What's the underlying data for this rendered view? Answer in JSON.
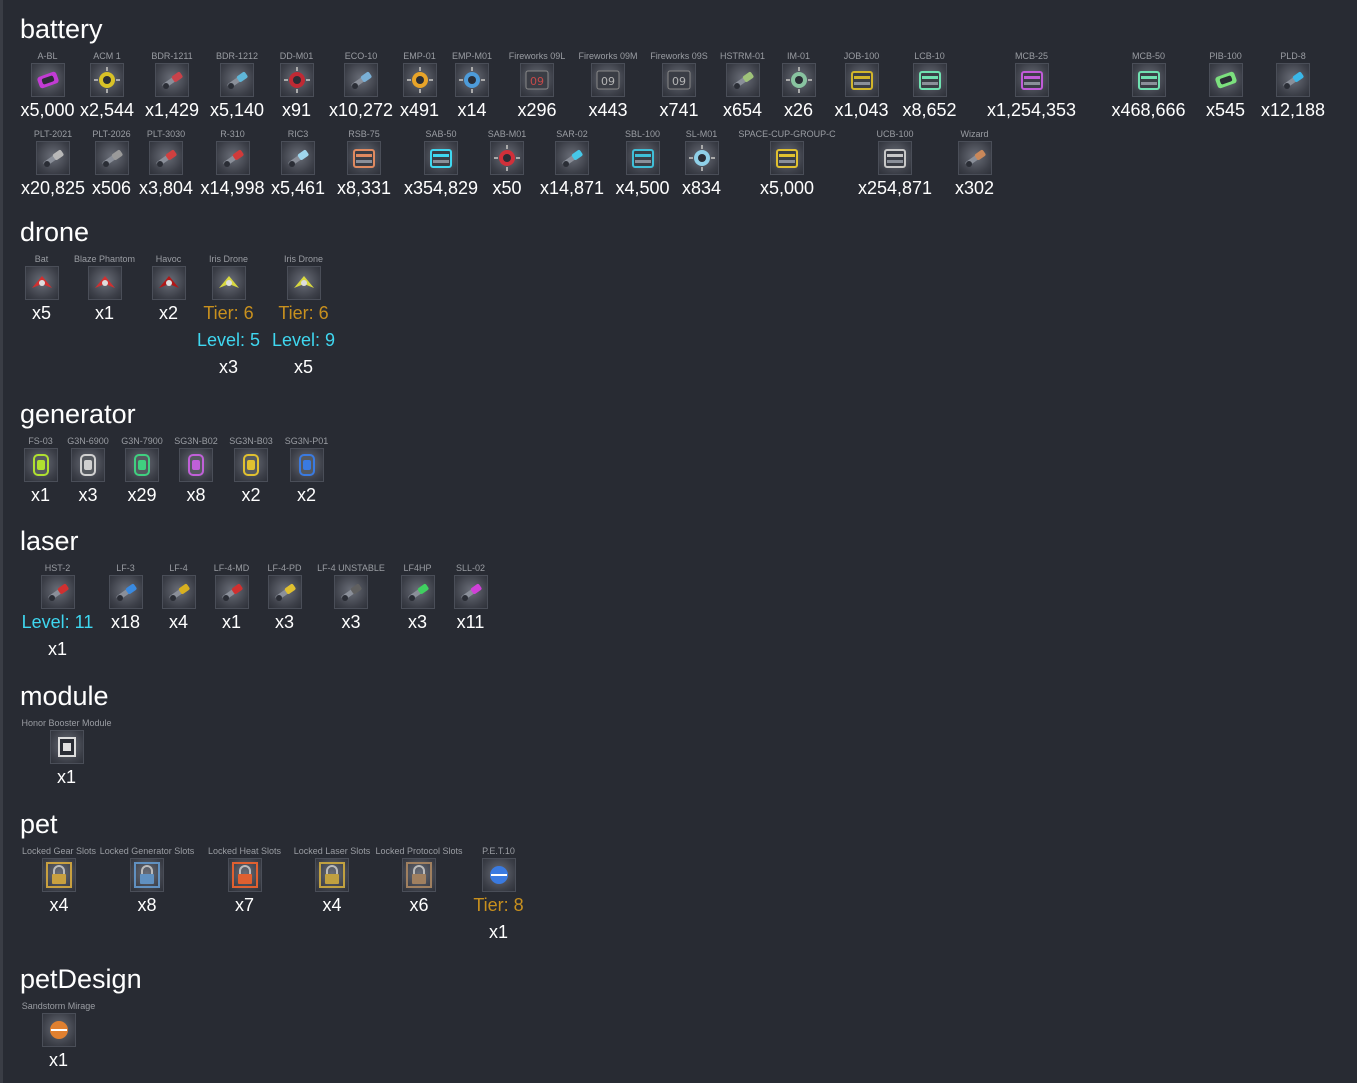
{
  "colors": {
    "background": "#282b33",
    "item_name": "#9a9da3",
    "tier": "#c8901e",
    "level": "#3fd7f0",
    "quantity": "#ffffff"
  },
  "categories": [
    {
      "title": "battery",
      "rows": [
        [
          {
            "name": "A-BL",
            "qty": "x5,000",
            "icon": "battery-abl-icon",
            "color": "#c23bd4"
          },
          {
            "name": "ACM 1",
            "qty": "x2,544",
            "icon": "mine-acm-icon",
            "color": "#d9c227"
          },
          {
            "name": "BDR-1211",
            "qty": "x1,429",
            "icon": "rocket-bdr1211-icon",
            "color": "#c9424a"
          },
          {
            "name": "BDR-1212",
            "qty": "x5,140",
            "icon": "rocket-bdr1212-icon",
            "color": "#5fb6d8"
          },
          {
            "name": "DD-M01",
            "qty": "x91",
            "icon": "mine-ddm01-icon",
            "color": "#c02a34"
          },
          {
            "name": "ECO-10",
            "qty": "x10,272",
            "icon": "rocket-eco10-icon",
            "color": "#7ab0d6"
          },
          {
            "name": "EMP-01",
            "qty": "x491",
            "icon": "emp-icon",
            "color": "#e8a429"
          },
          {
            "name": "EMP-M01",
            "qty": "x14",
            "icon": "mine-empm01-icon",
            "color": "#4d9bd9"
          },
          {
            "name": "Fireworks 09L",
            "qty": "x296",
            "icon": "fireworks-large-icon",
            "color": "#c64a4a"
          },
          {
            "name": "Fireworks 09M",
            "qty": "x443",
            "icon": "fireworks-medium-icon",
            "color": "#b5b5b5"
          },
          {
            "name": "Fireworks 09S",
            "qty": "x741",
            "icon": "fireworks-small-icon",
            "color": "#b5b5b5"
          },
          {
            "name": "HSTRM-01",
            "qty": "x654",
            "icon": "rocket-hstrm-icon",
            "color": "#9fc37a"
          },
          {
            "name": "IM-01",
            "qty": "x26",
            "icon": "mine-im01-icon",
            "color": "#88c3a0"
          },
          {
            "name": "JOB-100",
            "qty": "x1,043",
            "icon": "crate-job100-icon",
            "color": "#d2b52a"
          },
          {
            "name": "LCB-10",
            "qty": "x8,652",
            "icon": "crate-lcb10-icon",
            "color": "#6fe0b0"
          },
          {
            "name": "MCB-25",
            "qty": "x1,254,353",
            "icon": "crate-mcb25-icon",
            "color": "#c15bd8"
          },
          {
            "name": "MCB-50",
            "qty": "x468,666",
            "icon": "crate-mcb50-icon",
            "color": "#6fe0b0"
          },
          {
            "name": "PIB-100",
            "qty": "x545",
            "icon": "battery-pib100-icon",
            "color": "#7ce07e"
          },
          {
            "name": "PLD-8",
            "qty": "x12,188",
            "icon": "rocket-pld8-icon",
            "color": "#3ab7e8"
          }
        ],
        [
          {
            "name": "PLT-2021",
            "qty": "x20,825",
            "icon": "rocket-plt2021-icon",
            "color": "#b8b8b8"
          },
          {
            "name": "PLT-2026",
            "qty": "x506",
            "icon": "rocket-plt2026-icon",
            "color": "#9a9a9a"
          },
          {
            "name": "PLT-3030",
            "qty": "x3,804",
            "icon": "rocket-plt3030-icon",
            "color": "#d04040"
          },
          {
            "name": "R-310",
            "qty": "x14,998",
            "icon": "rocket-r310-icon",
            "color": "#d03a3a"
          },
          {
            "name": "RIC3",
            "qty": "x5,461",
            "icon": "rocket-ric3-icon",
            "color": "#9fd7ee"
          },
          {
            "name": "RSB-75",
            "qty": "x8,331",
            "icon": "crate-rsb75-icon",
            "color": "#e08a60"
          },
          {
            "name": "SAB-50",
            "qty": "x354,829",
            "icon": "crate-sab50-icon",
            "color": "#3fd7f0"
          },
          {
            "name": "SAB-M01",
            "qty": "x50",
            "icon": "mine-sabm01-icon",
            "color": "#d0303a"
          },
          {
            "name": "SAR-02",
            "qty": "x14,871",
            "icon": "rocket-sar02-icon",
            "color": "#46c8e8"
          },
          {
            "name": "SBL-100",
            "qty": "x4,500",
            "icon": "crate-sbl100-icon",
            "color": "#3fbfd8"
          },
          {
            "name": "SL-M01",
            "qty": "x834",
            "icon": "mine-slm01-icon",
            "color": "#8fd0e8"
          },
          {
            "name": "SPACE-CUP-GROUP-C",
            "qty": "x5,000",
            "icon": "space-cup-icon",
            "color": "#e0c030"
          },
          {
            "name": "UCB-100",
            "qty": "x254,871",
            "icon": "crate-ucb100-icon",
            "color": "#c8c8c8"
          },
          {
            "name": "Wizard",
            "qty": "x302",
            "icon": "rocket-wizard-icon",
            "color": "#c9885a"
          }
        ]
      ]
    },
    {
      "title": "drone",
      "rows": [
        [
          {
            "name": "Bat",
            "qty": "x5",
            "icon": "drone-bat-icon",
            "color": "#d03030"
          },
          {
            "name": "Blaze Phantom",
            "qty": "x1",
            "icon": "drone-blaze-phantom-icon",
            "color": "#d03030"
          },
          {
            "name": "Havoc",
            "qty": "x2",
            "icon": "drone-havoc-icon",
            "color": "#b01818"
          },
          {
            "name": "Iris Drone",
            "tier": "Tier: 6",
            "level": "Level: 5",
            "qty": "x3",
            "icon": "drone-iris-icon",
            "color": "#d8d840"
          },
          {
            "name": "Iris Drone",
            "tier": "Tier: 6",
            "level": "Level: 9",
            "qty": "x5",
            "icon": "drone-iris-icon",
            "color": "#d8d840"
          }
        ]
      ]
    },
    {
      "title": "generator",
      "rows": [
        [
          {
            "name": "FS-03",
            "qty": "x1",
            "icon": "generator-fs03-icon",
            "color": "#b0e030"
          },
          {
            "name": "G3N-6900",
            "qty": "x3",
            "icon": "generator-g3n6900-icon",
            "color": "#d0d0d0"
          },
          {
            "name": "G3N-7900",
            "qty": "x29",
            "icon": "generator-g3n7900-icon",
            "color": "#40d080"
          },
          {
            "name": "SG3N-B02",
            "qty": "x8",
            "icon": "shield-sg3nb02-icon",
            "color": "#c060d8"
          },
          {
            "name": "SG3N-B03",
            "qty": "x2",
            "icon": "shield-sg3nb03-icon",
            "color": "#e0c030"
          },
          {
            "name": "SG3N-P01",
            "qty": "x2",
            "icon": "shield-sg3np01-icon",
            "color": "#3a7ae0"
          }
        ]
      ]
    },
    {
      "title": "laser",
      "rows": [
        [
          {
            "name": "HST-2",
            "level": "Level: 11",
            "qty": "x1",
            "icon": "laser-hst2-icon",
            "color": "#d03030"
          },
          {
            "name": "LF-3",
            "qty": "x18",
            "icon": "laser-lf3-icon",
            "color": "#3a8ae0"
          },
          {
            "name": "LF-4",
            "qty": "x4",
            "icon": "laser-lf4-icon",
            "color": "#d8b020"
          },
          {
            "name": "LF-4-MD",
            "qty": "x1",
            "icon": "laser-lf4md-icon",
            "color": "#d03030"
          },
          {
            "name": "LF-4-PD",
            "qty": "x3",
            "icon": "laser-lf4pd-icon",
            "color": "#e0c030"
          },
          {
            "name": "LF-4 UNSTABLE",
            "qty": "x3",
            "icon": "laser-lf4-unstable-icon",
            "color": "#606060"
          },
          {
            "name": "LF4HP",
            "qty": "x3",
            "icon": "laser-lf4hp-icon",
            "color": "#40d060"
          },
          {
            "name": "SLL-02",
            "qty": "x11",
            "icon": "laser-sll02-icon",
            "color": "#d040d8"
          }
        ]
      ]
    },
    {
      "title": "module",
      "rows": [
        [
          {
            "name": "Honor Booster Module",
            "qty": "x1",
            "icon": "honor-booster-module-icon",
            "color": "#e0e0e0"
          }
        ]
      ]
    },
    {
      "title": "pet",
      "rows": [
        [
          {
            "name": "Locked Gear Slots",
            "qty": "x4",
            "icon": "lock-gear-icon",
            "color": "#c8a040"
          },
          {
            "name": "Locked Generator Slots",
            "qty": "x8",
            "icon": "lock-generator-icon",
            "color": "#6090c0"
          },
          {
            "name": "Locked Heat Slots",
            "qty": "x7",
            "icon": "lock-heat-icon",
            "color": "#e06030"
          },
          {
            "name": "Locked Laser Slots",
            "qty": "x4",
            "icon": "lock-laser-icon",
            "color": "#c0a040"
          },
          {
            "name": "Locked Protocol Slots",
            "qty": "x6",
            "icon": "lock-protocol-icon",
            "color": "#a08060"
          },
          {
            "name": "P.E.T.10",
            "tier": "Tier: 8",
            "qty": "x1",
            "icon": "pet10-icon",
            "color": "#3a7ae0"
          }
        ]
      ]
    },
    {
      "title": "petDesign",
      "rows": [
        [
          {
            "name": "Sandstorm Mirage",
            "qty": "x1",
            "icon": "pet-sandstorm-mirage-icon",
            "color": "#e08030"
          }
        ]
      ]
    }
  ]
}
